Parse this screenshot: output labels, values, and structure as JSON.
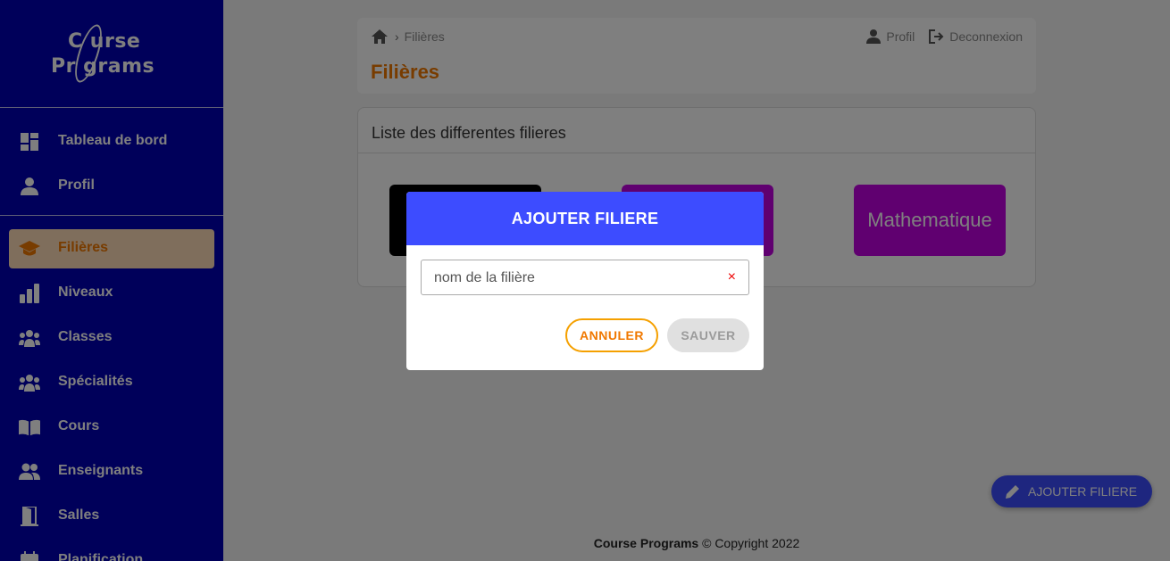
{
  "app": {
    "logo_line1": "C  urse",
    "logo_line2": "Pr   grams"
  },
  "sidebar": {
    "items": [
      {
        "label": "Tableau de bord",
        "icon": "dashboard-icon"
      },
      {
        "label": "Profil",
        "icon": "person-icon"
      },
      {
        "label": "Filières",
        "icon": "graduation-cap-icon",
        "active": true
      },
      {
        "label": "Niveaux",
        "icon": "bar-chart-icon"
      },
      {
        "label": "Classes",
        "icon": "group-icon"
      },
      {
        "label": "Spécialités",
        "icon": "group-icon"
      },
      {
        "label": "Cours",
        "icon": "book-icon"
      },
      {
        "label": "Enseignants",
        "icon": "people-icon"
      },
      {
        "label": "Salles",
        "icon": "door-icon"
      },
      {
        "label": "Planification",
        "icon": "calendar-icon"
      }
    ]
  },
  "header": {
    "breadcrumb": "Filières",
    "title": "Filières",
    "profile_label": "Profil",
    "logout_label": "Deconnexion"
  },
  "list": {
    "title": "Liste des differentes filieres",
    "tiles": [
      {
        "label": "",
        "color": "#000000"
      },
      {
        "label": "",
        "color": "#c000e0"
      },
      {
        "label": "Mathematique",
        "color": "#c000e0"
      }
    ]
  },
  "footer": {
    "brand": "Course Programs",
    "copyright": " © Copyright 2022"
  },
  "fab": {
    "label": "AJOUTER FILIERE"
  },
  "modal": {
    "title": "AJOUTER FILIERE",
    "input_placeholder": "nom de la filière",
    "input_value": "",
    "clear_symbol": "×",
    "cancel_label": "ANNULER",
    "save_label": "SAUVER"
  },
  "colors": {
    "sidebar": "#0000b4",
    "accent": "#f07800",
    "primary": "#3d4cff"
  }
}
